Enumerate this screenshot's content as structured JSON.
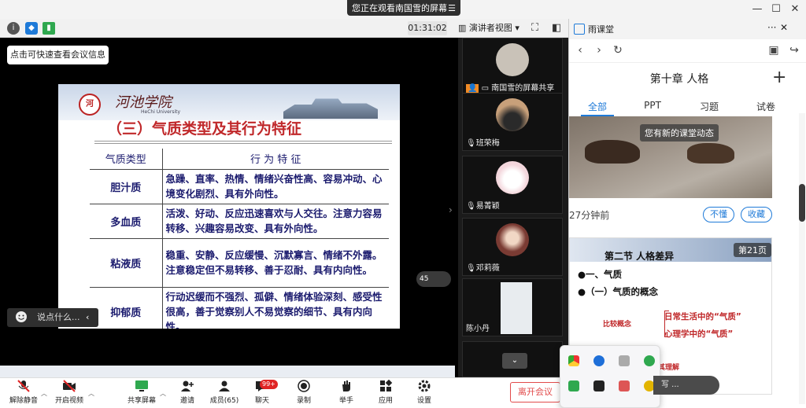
{
  "banner": {
    "text": "您正在观看南国雪的屏幕",
    "menu_icon": "menu-icon"
  },
  "meeting_toolbar": {
    "info_tooltip": "点击可快速查看会议信息",
    "timer": "01:31:02",
    "view_mode": "演讲者视图"
  },
  "slide": {
    "college_name": "河池学院",
    "college_sub": "HeChi University",
    "title": "（三）气质类型及其行为特征",
    "col_type": "气质类型",
    "col_feature": "行 为 特 征",
    "rows": [
      {
        "name": "胆汁质",
        "desc": "急躁、直率、热情、情绪兴奋性高、容易冲动、心境变化剧烈、具有外向性。"
      },
      {
        "name": "多血质",
        "desc": "活泼、好动、反应迅速喜欢与人交往。注意力容易转移、兴趣容易改变、具有外向性。"
      },
      {
        "name": "粘液质",
        "desc": "稳重、安静、反应缓慢、沉默寡言、情绪不外露。注意稳定但不易转移、善于忍耐、具有内向性。"
      },
      {
        "name": "抑郁质",
        "desc": "行动迟缓而不强烈、孤僻、情绪体验深刻、感受性很高，善于觉察别人不易觉察的细节、具有内向性。"
      }
    ],
    "zoom_badge": "45",
    "chat_placeholder": "说点什么..."
  },
  "participants": [
    {
      "name": "南国雪的屏幕共享",
      "avatar_color": "#c9c2b8"
    },
    {
      "name": "班荣梅",
      "avatar_color": "#c8a07a"
    },
    {
      "name": "易菁颖",
      "avatar_color": "#f3d6dc"
    },
    {
      "name": "邓莉薇",
      "avatar_color": "#7a3b33"
    },
    {
      "name": "陈小丹",
      "avatar_color": "#e8ecef"
    }
  ],
  "controls": {
    "unmute": "解除静音",
    "video": "开启视频",
    "share": "共享屏幕",
    "invite": "邀请",
    "members": "成员(65)",
    "chat": "聊天",
    "chat_badge": "99+",
    "record": "录制",
    "raise_hand": "举手",
    "apps": "应用",
    "settings": "设置",
    "leave": "离开会议"
  },
  "right_panel": {
    "tab_title": "雨课堂",
    "chapter_title": "第十章 人格",
    "tabs": [
      "全部",
      "PPT",
      "习题",
      "试卷"
    ],
    "new_activity": "您有新的课堂动态",
    "ago": "27分钟前",
    "dont_understand": "不懂",
    "favorite": "收藏",
    "card": {
      "section": "第二节  人格差异",
      "page": "第21页",
      "line1": "●一、气质",
      "line2": "●（一）气质的概念",
      "compare_label": "比较概念",
      "item1": "日常生活中的“气质”",
      "item2": "心理学中的“气质”",
      "bottom": "其理解"
    }
  },
  "input_bubble": "写 ..."
}
